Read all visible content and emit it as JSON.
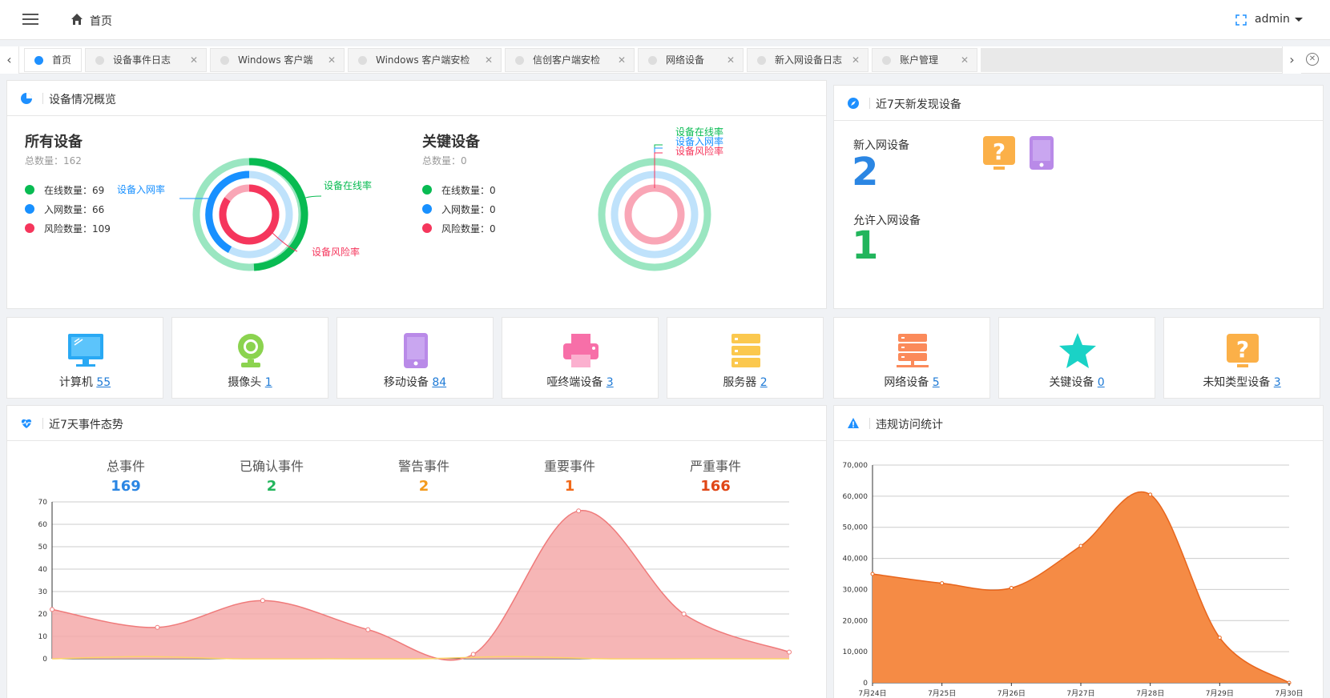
{
  "header": {
    "breadcrumb": "首页",
    "user": "admin",
    "icons": [
      "menu-icon",
      "home-icon",
      "fullscreen-icon"
    ]
  },
  "tabs": [
    {
      "label": "首页",
      "active": true,
      "closable": false
    },
    {
      "label": "设备事件日志",
      "active": false,
      "closable": true
    },
    {
      "label": "Windows 客户端",
      "active": false,
      "closable": true
    },
    {
      "label": "Windows 客户端安检",
      "active": false,
      "closable": true
    },
    {
      "label": "信创客户端安检",
      "active": false,
      "closable": true
    },
    {
      "label": "网络设备",
      "active": false,
      "closable": true
    },
    {
      "label": "新入网设备日志",
      "active": false,
      "closable": true
    },
    {
      "label": "账户管理",
      "active": false,
      "closable": true
    }
  ],
  "overview": {
    "title": "设备情况概览",
    "all": {
      "title": "所有设备",
      "total": "总数量：162",
      "legend": [
        "在线数量：69",
        "入网数量：66",
        "风险数量：109"
      ],
      "online_rate_label": "设备在线率",
      "network_rate_label": "设备入网率",
      "risk_rate_label": "设备风险率"
    },
    "key": {
      "title": "关键设备",
      "total": "总数量：0",
      "legend": [
        "在线数量：0",
        "入网数量：0",
        "风险数量：0"
      ],
      "online_rate_label": "设备在线率",
      "network_rate_label": "设备入网率",
      "risk_rate_label": "设备风险率"
    }
  },
  "new_devices": {
    "title": "近7天新发现设备",
    "new_label": "新入网设备",
    "new_count": "2",
    "allowed_label": "允许入网设备",
    "allowed_count": "1",
    "icons": [
      "unknown-device-icon",
      "mobile-device-icon"
    ]
  },
  "device_cards": [
    {
      "label": "计算机",
      "count": "55",
      "icon": "computer-icon",
      "color": "#29a9f4"
    },
    {
      "label": "摄像头",
      "count": "1",
      "icon": "camera-icon",
      "color": "#8bd34f"
    },
    {
      "label": "移动设备",
      "count": "84",
      "icon": "mobile-icon",
      "color": "#b98ae8"
    },
    {
      "label": "哑终端设备",
      "count": "3",
      "icon": "printer-icon",
      "color": "#f76fa8"
    },
    {
      "label": "服务器",
      "count": "2",
      "icon": "server-icon",
      "color": "#fbc84e"
    },
    {
      "label": "网络设备",
      "count": "5",
      "icon": "network-device-icon",
      "color": "#fb8a5a"
    },
    {
      "label": "关键设备",
      "count": "0",
      "icon": "star-icon",
      "color": "#1ad2c6"
    },
    {
      "label": "未知类型设备",
      "count": "3",
      "icon": "unknown-icon",
      "color": "#fbb048"
    }
  ],
  "events": {
    "title": "近7天事件态势",
    "stats": [
      {
        "label": "总事件",
        "value": "169",
        "color": "#2b86e3"
      },
      {
        "label": "已确认事件",
        "value": "2",
        "color": "#22b55c"
      },
      {
        "label": "警告事件",
        "value": "2",
        "color": "#f39a1c"
      },
      {
        "label": "重要事件",
        "value": "1",
        "color": "#f26a1b"
      },
      {
        "label": "严重事件",
        "value": "166",
        "color": "#e04616"
      }
    ],
    "legend": [
      "警告事件",
      "重要事件",
      "严重事件"
    ]
  },
  "violations": {
    "title": "违规访问统计"
  },
  "chart_data": [
    {
      "type": "area",
      "title": "近7天事件态势",
      "xlabel": "",
      "ylabel": "",
      "ylim": [
        0,
        70
      ],
      "yticks": [
        0,
        10,
        20,
        30,
        40,
        50,
        60,
        70
      ],
      "grid": true,
      "legend_position": "top-right",
      "series": [
        {
          "name": "警告事件",
          "color": "#fcd36b",
          "values": [
            0,
            1,
            0,
            0,
            0,
            1,
            0,
            0,
            0
          ]
        },
        {
          "name": "重要事件",
          "color": "#f79a6a",
          "values": [
            0,
            0,
            0,
            0,
            0,
            0,
            0,
            0,
            0
          ]
        },
        {
          "name": "严重事件",
          "color": "#ef7a7a",
          "values": [
            22,
            14,
            26,
            13,
            2,
            66,
            20,
            3
          ]
        }
      ]
    },
    {
      "type": "area",
      "title": "违规访问统计",
      "xlabel": "",
      "ylabel": "",
      "categories": [
        "7月24日",
        "7月25日",
        "7月26日",
        "7月27日",
        "7月28日",
        "7月29日",
        "7月30日"
      ],
      "ytick_labels": [
        "0",
        "10,000",
        "20,000",
        "30,000",
        "40,000",
        "50,000",
        "60,000",
        "70,000"
      ],
      "ylim": [
        0,
        70000
      ],
      "grid": true,
      "series": [
        {
          "name": "",
          "color": "#f3823a",
          "values": [
            35000,
            32000,
            30500,
            44000,
            60500,
            14500,
            0
          ]
        }
      ]
    }
  ]
}
